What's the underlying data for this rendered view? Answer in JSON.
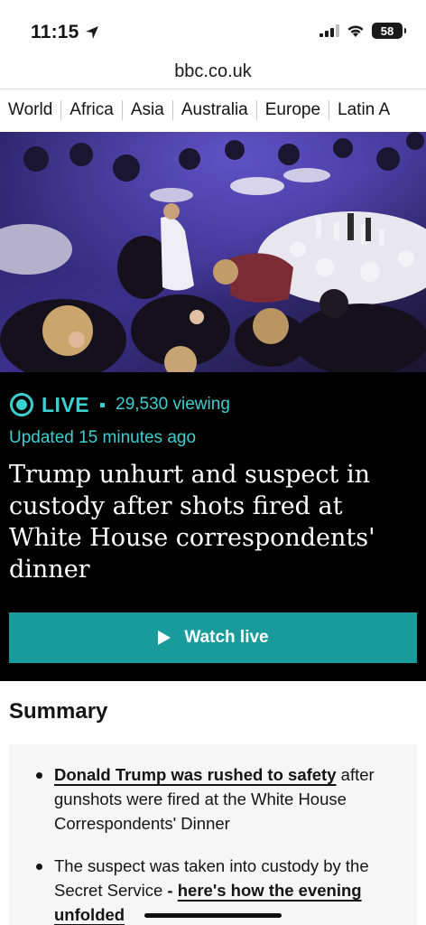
{
  "status_bar": {
    "time": "11:15",
    "battery": "58"
  },
  "url_bar": {
    "domain": "bbc.co.uk"
  },
  "nav": {
    "items": [
      "World",
      "Africa",
      "Asia",
      "Australia",
      "Europe",
      "Latin A"
    ]
  },
  "live": {
    "label": "LIVE",
    "viewing": "29,530 viewing",
    "updated": "Updated 15 minutes ago",
    "headline": "Trump unhurt and suspect in custody after shots fired at White House correspondents' dinner",
    "watch_label": "Watch live"
  },
  "summary": {
    "title": "Summary",
    "item1_link": "Donald Trump was rushed to safety",
    "item1_text": "after gunshots were fired at the White House Correspondents' Dinner",
    "item2_text": "The suspect was taken into custody by the Secret Service",
    "item2_dash": " - ",
    "item2_link": "here's how the evening unfolded"
  },
  "colors": {
    "accent": "#3ccfcf",
    "button": "#1a9b9b",
    "live_bg": "#000000"
  }
}
